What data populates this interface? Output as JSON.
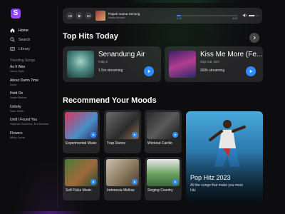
{
  "logo": "S",
  "nav": [
    {
      "label": "Home",
      "icon": "home-icon",
      "active": true
    },
    {
      "label": "Search",
      "icon": "search-icon",
      "active": false
    },
    {
      "label": "Library",
      "icon": "library-icon",
      "active": false
    }
  ],
  "trending": {
    "title": "Trending Songs",
    "items": [
      {
        "title": "As It Was",
        "artist": "Harry Style"
      },
      {
        "title": "About Damn Time",
        "artist": "Lizzo"
      },
      {
        "title": "Hold On",
        "artist": "Justin Bieber"
      },
      {
        "title": "Unholy",
        "artist": "Sam Smith"
      },
      {
        "title": "Until I Found You",
        "artist": "Stephen Sanchez, Em Beihold"
      },
      {
        "title": "Flowers",
        "artist": "Miley Cyrus"
      }
    ]
  },
  "player": {
    "title": "Papah mama Senang",
    "artist": "Nadin Amizah",
    "progress": 0.07,
    "elapsed": "0:12",
    "total": "4:03",
    "volume": 0.55
  },
  "top_hits": {
    "title": "Top Hits Today",
    "items": [
      {
        "title": "Senandung Air",
        "artist": "Faby Z",
        "streams": "1.5m streaming"
      },
      {
        "title": "Kiss Me More (Fe...",
        "artist": "Doja Cat, SZA",
        "streams": "900k streaming"
      }
    ]
  },
  "moods": {
    "title": "Recommend Your Moods",
    "items": [
      {
        "label": "Experimental Music"
      },
      {
        "label": "Trap Dance"
      },
      {
        "label": "Workout Cardio"
      },
      {
        "label": "Soft Floks Music"
      },
      {
        "label": "Indonesia Mellow"
      },
      {
        "label": "Singing Country"
      }
    ],
    "feature": {
      "title": "Pop Hitz 2023",
      "subtitle": "All the songs that make you more hitz"
    }
  },
  "colors": {
    "accent": "#2f8cff",
    "brand": "#8a3dff"
  }
}
